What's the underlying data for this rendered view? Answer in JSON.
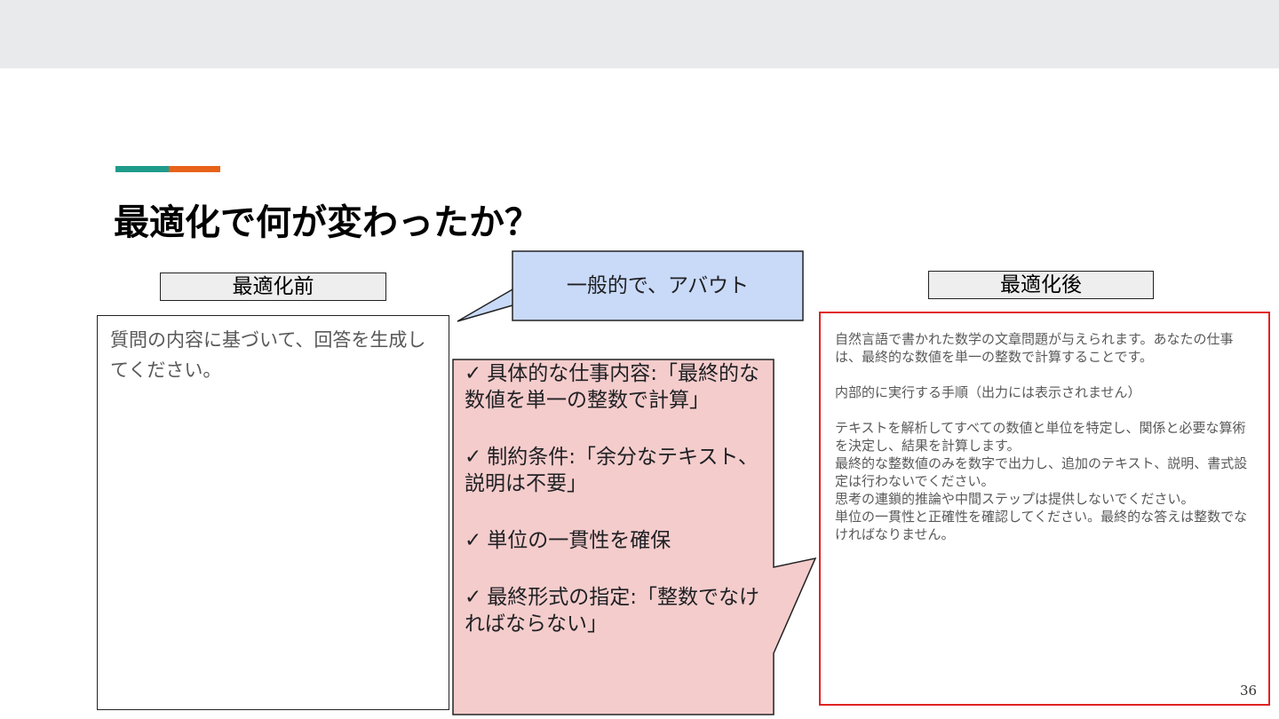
{
  "slide": {
    "title": "最適化で何が変わったか？",
    "page_number": "36"
  },
  "before": {
    "label": "最適化前",
    "prompt": "質問の内容に基づいて、回答を生成してください。"
  },
  "callout": {
    "text": "一般的で、アバウト"
  },
  "improvements": {
    "check_glyph": "✓",
    "items": [
      "具体的な仕事内容:「最終的な数値を単一の整数で計算」",
      "制約条件:「余分なテキスト、説明は不要」",
      "単位の一貫性を確保",
      "最終形式の指定:「整数でなければならない」"
    ]
  },
  "after": {
    "label": "最適化後",
    "paragraphs": [
      [
        "自然言語で書かれた数学の文章問題が与えられます。あなたの仕事は、最終的な数値を単一の整数で計算することです。"
      ],
      [
        "内部的に実行する手順（出力には表示されません）"
      ],
      [
        "テキストを解析してすべての数値と単位を特定し、関係と必要な算術を決定し、結果を計算します。",
        "最終的な整数値のみを数字で出力し、追加のテキスト、説明、書式設定は行わないでください。",
        "思考の連鎖的推論や中間ステップは提供しないでください。",
        "単位の一貫性と正確性を確認してください。最終的な答えは整数でなければなりません。"
      ]
    ]
  },
  "colors": {
    "accent_teal": "#1e9b8b",
    "accent_orange": "#e8621a",
    "callout_fill": "#c9daf8",
    "improvements_fill": "#f4cccc",
    "after_border": "#e02222"
  }
}
